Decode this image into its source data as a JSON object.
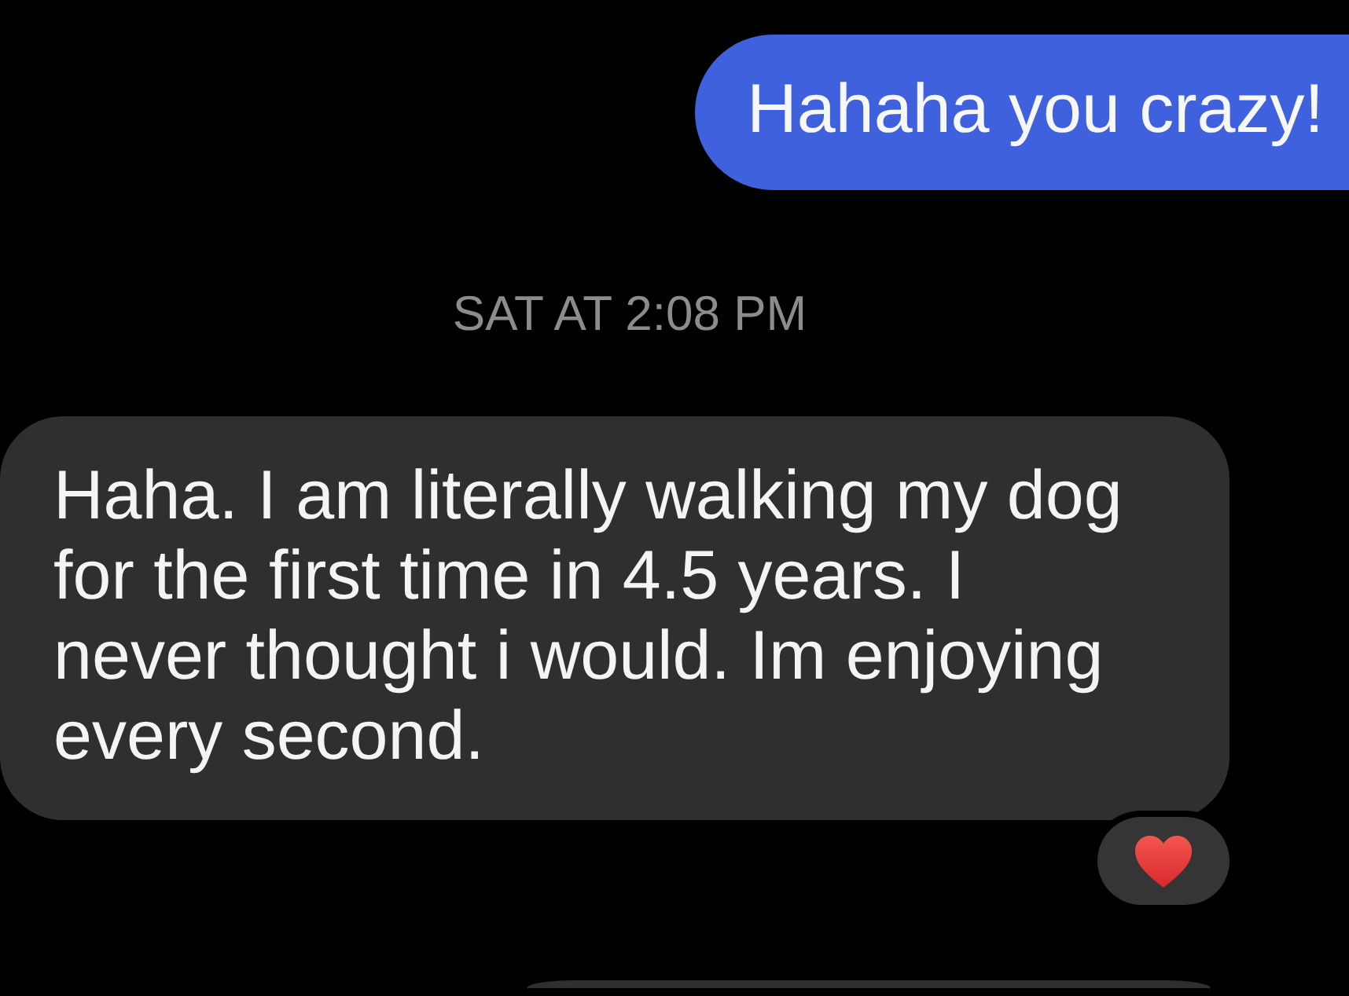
{
  "messages": [
    {
      "kind": "sent",
      "text": "Hahaha you crazy!"
    },
    {
      "kind": "timestamp",
      "text": "SAT AT 2:08 PM"
    },
    {
      "kind": "received",
      "text": "Haha. I am literally walking my dog for the first time in 4.5 years. I never thought i would. Im enjoying every second.",
      "reactions": [
        {
          "kind": "heart"
        }
      ]
    },
    {
      "kind": "partial"
    }
  ]
}
